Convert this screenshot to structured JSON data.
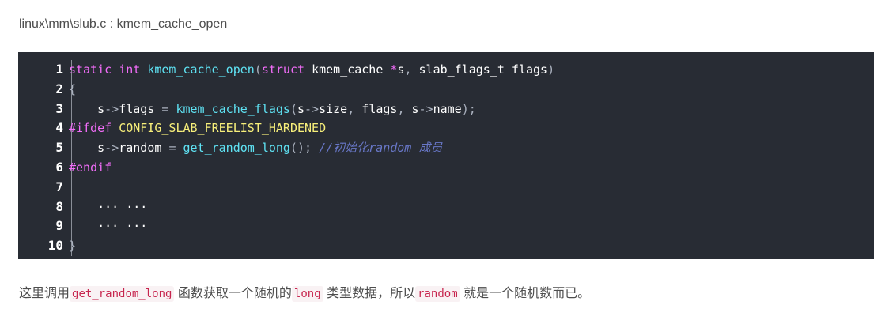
{
  "file_path": "linux\\mm\\slub.c : kmem_cache_open",
  "code": {
    "line_numbers": [
      "1",
      "2",
      "3",
      "4",
      "5",
      "6",
      "7",
      "8",
      "9",
      "10"
    ],
    "lines": [
      [
        [
          "kw",
          "static "
        ],
        [
          "kw",
          "int "
        ],
        [
          "fn",
          "kmem_cache_open"
        ],
        [
          "op",
          "("
        ],
        [
          "kw",
          "struct "
        ],
        [
          "pl",
          "kmem_cache "
        ],
        [
          "kw",
          "*"
        ],
        [
          "pl",
          "s"
        ],
        [
          "op",
          ", "
        ],
        [
          "pl",
          "slab_flags_t flags"
        ],
        [
          "op",
          ")"
        ]
      ],
      [
        [
          "op",
          "{"
        ]
      ],
      [
        [
          "pl",
          "    s"
        ],
        [
          "op",
          "->"
        ],
        [
          "pl",
          "flags "
        ],
        [
          "op",
          "= "
        ],
        [
          "fn",
          "kmem_cache_flags"
        ],
        [
          "op",
          "("
        ],
        [
          "pl",
          "s"
        ],
        [
          "op",
          "->"
        ],
        [
          "pl",
          "size"
        ],
        [
          "op",
          ", "
        ],
        [
          "pl",
          "flags"
        ],
        [
          "op",
          ", "
        ],
        [
          "pl",
          "s"
        ],
        [
          "op",
          "->"
        ],
        [
          "pl",
          "name"
        ],
        [
          "op",
          ");"
        ]
      ],
      [
        [
          "kw",
          "#ifdef "
        ],
        [
          "pp",
          "CONFIG_SLAB_FREELIST_HARDENED"
        ]
      ],
      [
        [
          "pl",
          "    s"
        ],
        [
          "op",
          "->"
        ],
        [
          "pl",
          "random "
        ],
        [
          "op",
          "= "
        ],
        [
          "fn",
          "get_random_long"
        ],
        [
          "op",
          "(); "
        ],
        [
          "cm",
          "//初始化random 成员"
        ]
      ],
      [
        [
          "kw",
          "#endif"
        ]
      ],
      [],
      [
        [
          "pl",
          "    ··· ···"
        ]
      ],
      [
        [
          "pl",
          "    ··· ···"
        ]
      ],
      [
        [
          "op",
          "}"
        ]
      ]
    ]
  },
  "paragraph": {
    "t1": "这里调用",
    "c1": "get_random_long",
    "t2": " 函数获取一个随机的",
    "c2": "long",
    "t3": " 类型数据，所以",
    "c3": "random",
    "t4": " 就是一个随机数而已。"
  }
}
